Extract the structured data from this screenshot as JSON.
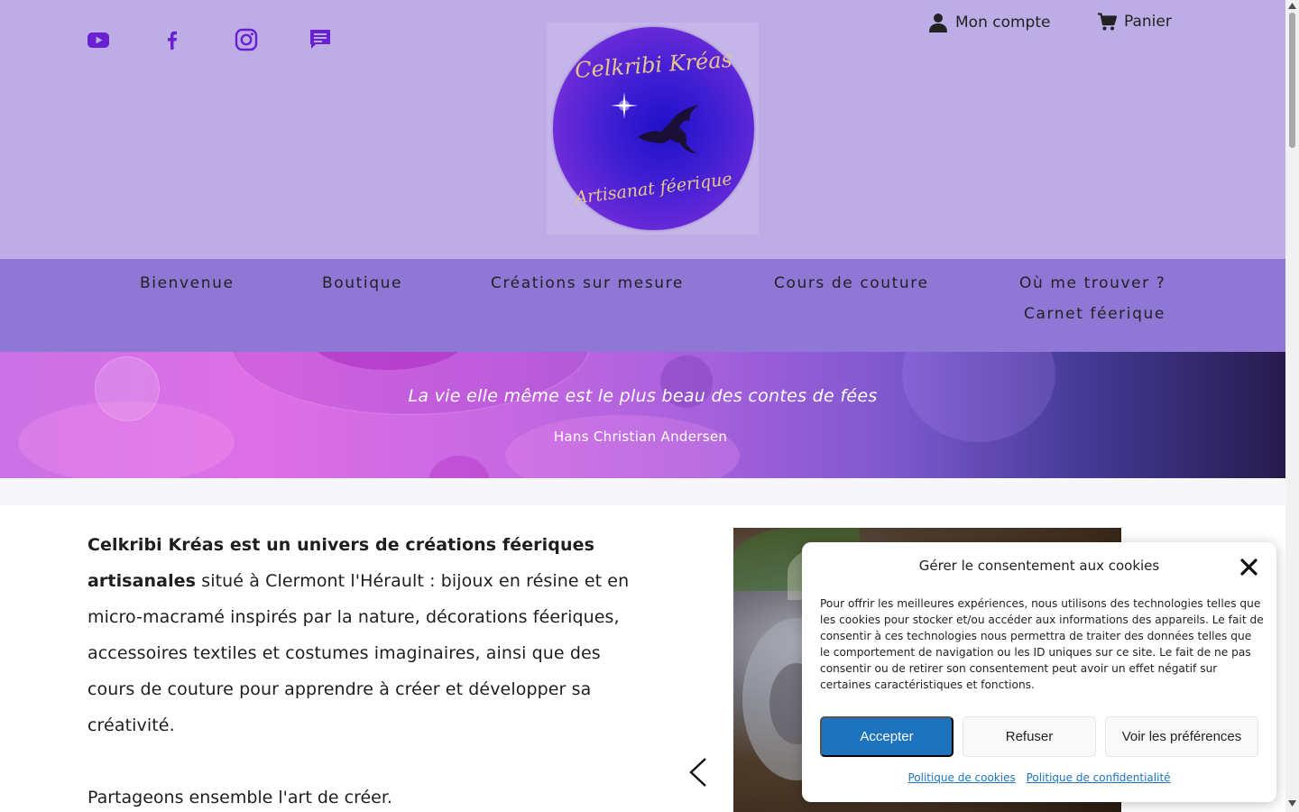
{
  "header": {
    "social": [
      {
        "name": "youtube-icon"
      },
      {
        "name": "facebook-icon"
      },
      {
        "name": "instagram-icon"
      },
      {
        "name": "message-icon"
      }
    ],
    "logo": {
      "top_text": "Celkribi Kréas",
      "bottom_text": "Artisanat féerique"
    },
    "account_label": "Mon compte",
    "cart_label": "Panier"
  },
  "nav": {
    "items": [
      {
        "label": "Bienvenue"
      },
      {
        "label": "Boutique"
      },
      {
        "label": "Créations sur mesure"
      },
      {
        "label": "Cours de couture"
      },
      {
        "label": "Où me trouver ?"
      },
      {
        "label": "Carnet féerique"
      }
    ]
  },
  "hero": {
    "quote": "La vie elle même est le plus beau des contes de fées",
    "author": "Hans Christian Andersen"
  },
  "intro": {
    "bold": "Celkribi Kréas est un univers de créations féeriques artisanales",
    "rest": " situé à Clermont l'Hérault : bijoux en résine et en micro-macramé inspirés par la nature, décorations féeriques, accessoires textiles et costumes imaginaires, ainsi que des cours de couture pour apprendre à créer et développer sa créativité.",
    "second": "Partageons ensemble l'art de créer."
  },
  "cookie": {
    "title": "Gérer le consentement aux cookies",
    "text": "Pour offrir les meilleures expériences, nous utilisons des technologies telles que les cookies pour stocker et/ou accéder aux informations des appareils. Le fait de consentir à ces technologies nous permettra de traiter des données telles que le comportement de navigation ou les ID uniques sur ce site. Le fait de ne pas consentir ou de retirer son consentement peut avoir un effet négatif sur certaines caractéristiques et fonctions.",
    "accept": "Accepter",
    "refuse": "Refuser",
    "prefs": "Voir les préférences",
    "cookie_policy": "Politique de cookies",
    "privacy_policy": "Politique de confidentialité"
  },
  "colors": {
    "header_bg": "#bdade6",
    "nav_bg": "#8e77d5",
    "icon": "#6a1fd0",
    "accept_btn": "#1e73be"
  }
}
